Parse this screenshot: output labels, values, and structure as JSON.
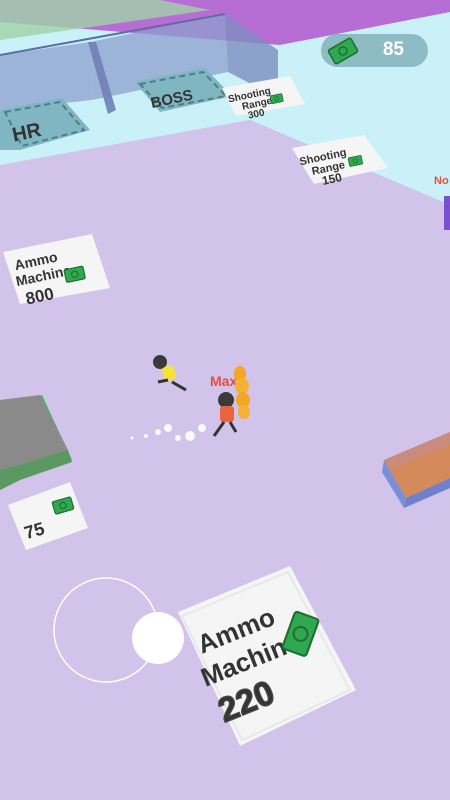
{
  "hud": {
    "cash": "85"
  },
  "zones": {
    "hr": "HR",
    "boss": "BOSS",
    "shooting_range_top": {
      "title_line1": "Shooting",
      "title_line2": "Range",
      "price": "300"
    },
    "shooting_range": {
      "title_line1": "Shooting",
      "title_line2": "Range",
      "price": "150"
    },
    "ammo_left": {
      "title_line1": "Ammo",
      "title_line2": "Machine",
      "price": "800"
    },
    "small_pad": {
      "price": "75"
    },
    "ammo_main": {
      "title_line1": "Ammo",
      "title_line2": "Machine",
      "price": "220"
    }
  },
  "characters": {
    "max_label": "Max",
    "npc_label": "No"
  },
  "colors": {
    "floor": "#d1c3ea",
    "cash_green": "#2f9e44",
    "name_red": "#e74c3c"
  }
}
